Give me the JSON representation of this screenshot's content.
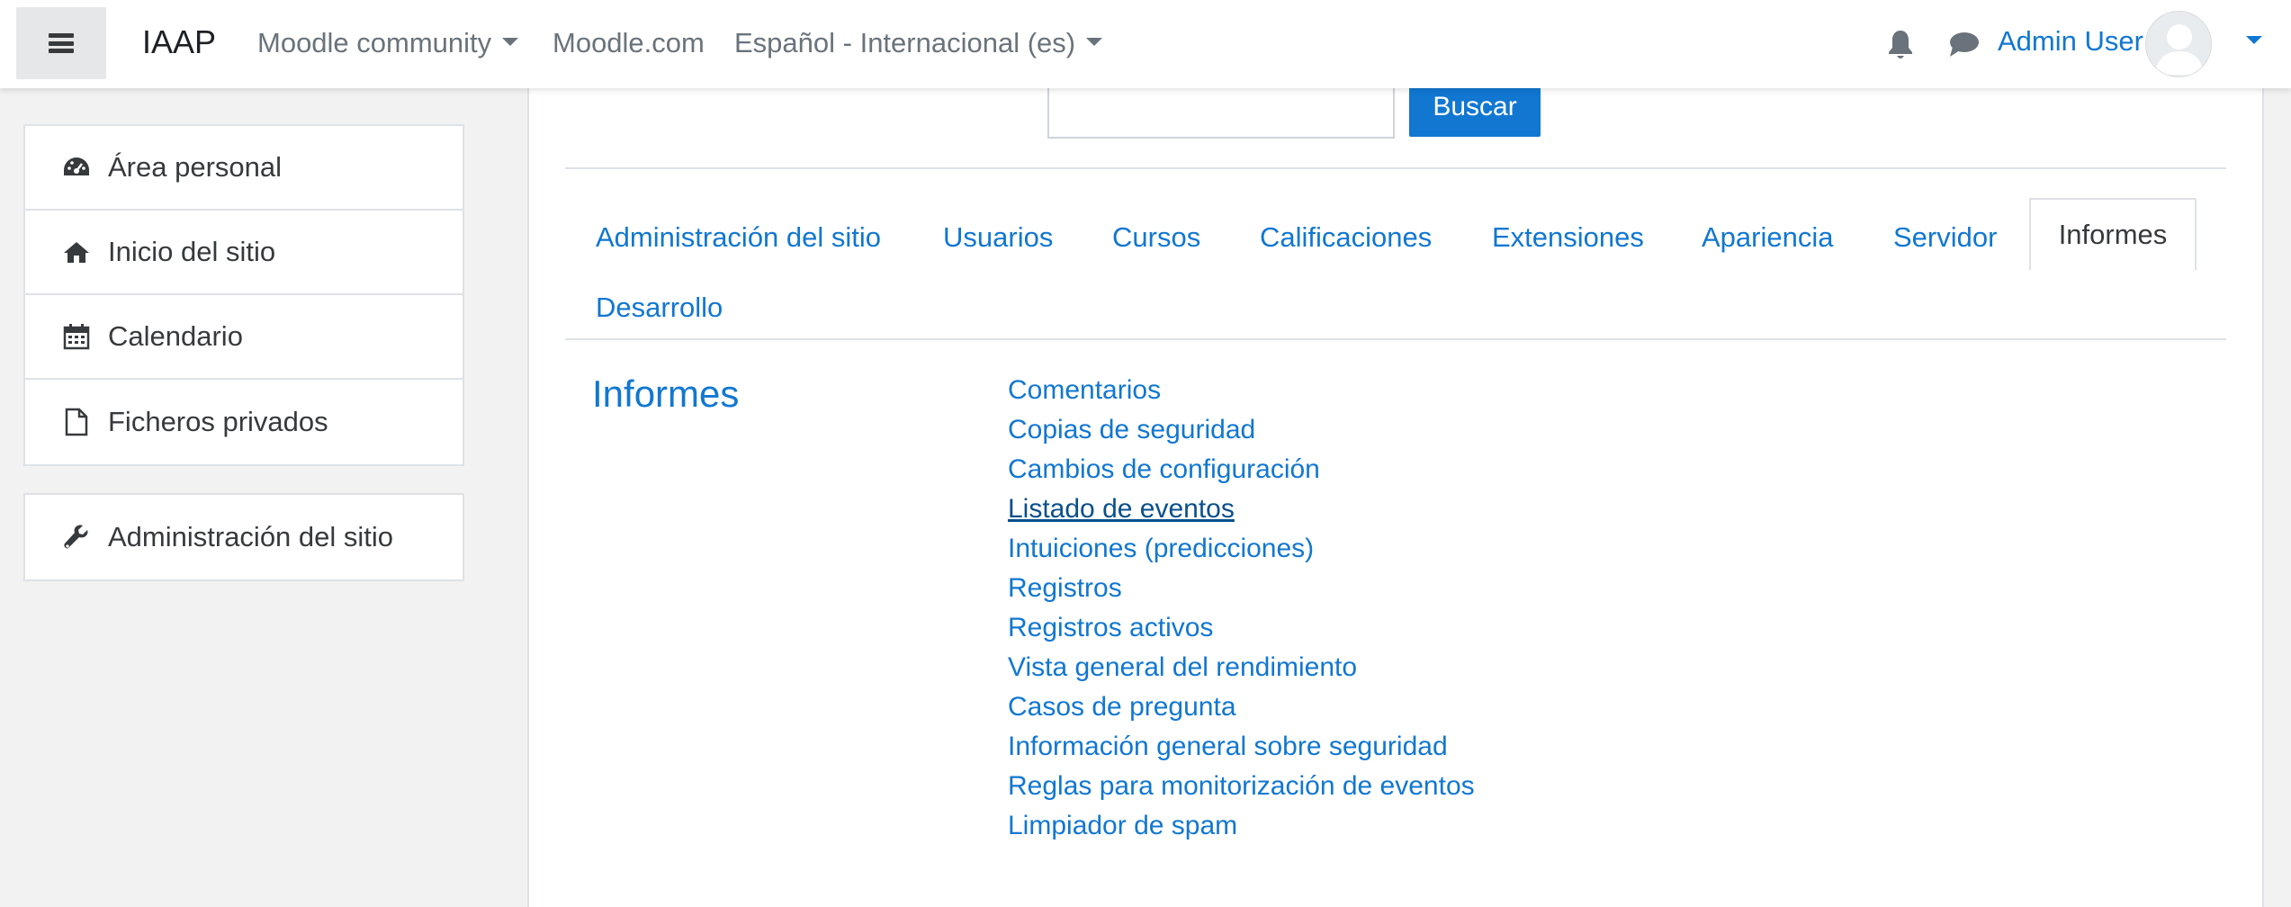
{
  "navbar": {
    "brand": "IAAP",
    "items": [
      {
        "label": "Moodle community",
        "dropdown": true
      },
      {
        "label": "Moodle.com",
        "dropdown": false
      },
      {
        "label": "Español - Internacional (es)",
        "dropdown": true
      }
    ],
    "user_name": "Admin User",
    "icons": [
      "menu-icon",
      "bell-icon",
      "chat-icon",
      "avatar-icon",
      "chevron-down-icon"
    ]
  },
  "sidebar": {
    "items": [
      {
        "label": "Área personal",
        "icon": "dashboard-icon"
      },
      {
        "label": "Inicio del sitio",
        "icon": "home-icon"
      },
      {
        "label": "Calendario",
        "icon": "calendar-icon"
      },
      {
        "label": "Ficheros privados",
        "icon": "file-icon"
      }
    ],
    "admin": {
      "label": "Administración del sitio",
      "icon": "wrench-icon"
    }
  },
  "search": {
    "value": "",
    "button_label": "Buscar"
  },
  "tabs": [
    {
      "label": "Administración del sitio",
      "active": false
    },
    {
      "label": "Usuarios",
      "active": false
    },
    {
      "label": "Cursos",
      "active": false
    },
    {
      "label": "Calificaciones",
      "active": false
    },
    {
      "label": "Extensiones",
      "active": false
    },
    {
      "label": "Apariencia",
      "active": false
    },
    {
      "label": "Servidor",
      "active": false
    },
    {
      "label": "Informes",
      "active": true
    },
    {
      "label": "Desarrollo",
      "active": false
    }
  ],
  "section": {
    "title": "Informes",
    "links": [
      "Comentarios",
      "Copias de seguridad",
      "Cambios de configuración",
      "Listado de eventos",
      "Intuiciones (predicciones)",
      "Registros",
      "Registros activos",
      "Vista general del rendimiento",
      "Casos de pregunta",
      "Información general sobre seguridad",
      "Reglas para monitorización de eventos",
      "Limpiador de spam"
    ],
    "hovered_link": "Listado de eventos"
  },
  "colors": {
    "link": "#1177d1",
    "primary_button": "#1177d1",
    "drawer_bg": "#f2f2f2",
    "text": "#373a3c"
  }
}
